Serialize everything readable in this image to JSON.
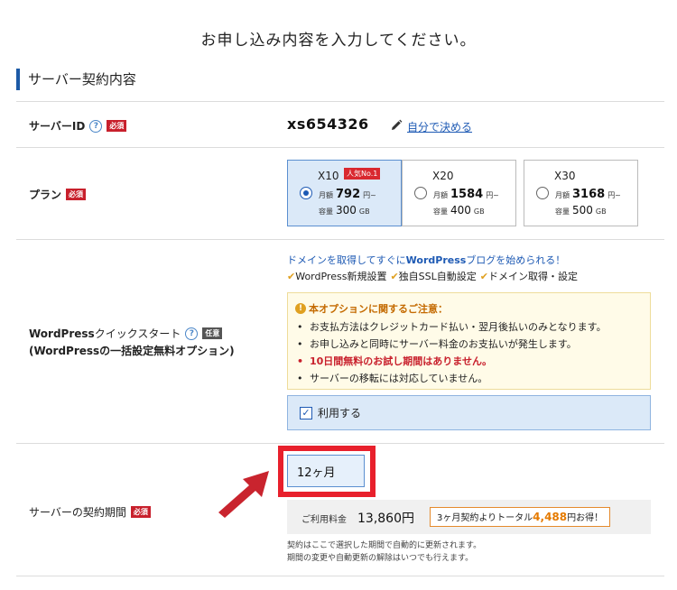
{
  "page": {
    "title": "お申し込み内容を入力してください。"
  },
  "section": {
    "title": "サーバー契約内容"
  },
  "server_id": {
    "label": "サーバーID",
    "help": "?",
    "required": "必須",
    "value": "xs654326",
    "edit_link": "自分で決める"
  },
  "plan": {
    "label": "プラン",
    "required": "必須",
    "options": [
      {
        "name": "X10",
        "badge": "人気No.1",
        "price_prefix": "月額",
        "price": "792",
        "price_unit": "円~",
        "capacity_prefix": "容量",
        "capacity": "300",
        "capacity_unit": "GB",
        "selected": true
      },
      {
        "name": "X20",
        "badge": "",
        "price_prefix": "月額",
        "price": "1584",
        "price_unit": "円~",
        "capacity_prefix": "容量",
        "capacity": "400",
        "capacity_unit": "GB",
        "selected": false
      },
      {
        "name": "X30",
        "badge": "",
        "price_prefix": "月額",
        "price": "3168",
        "price_unit": "円~",
        "capacity_prefix": "容量",
        "capacity": "500",
        "capacity_unit": "GB",
        "selected": false
      }
    ]
  },
  "wordpress": {
    "label_line1_bold": "WordPress",
    "label_line1_rest": "クイックスタート",
    "help": "?",
    "optional": "任意",
    "label_line2": "(WordPressの一括設定無料オプション)",
    "lead_prefix": "ドメインを取得してすぐに",
    "lead_bold": "WordPress",
    "lead_suffix": "ブログを始められる！",
    "features": [
      "WordPress新規設置",
      "独自SSL自動設定",
      "ドメイン取得・設定"
    ],
    "notice_title": "本オプションに関するご注意：",
    "notice_items": [
      "お支払方法はクレジットカード払い・翌月後払いのみとなります。",
      "お申し込みと同時にサーバー料金のお支払いが発生します。",
      "10日間無料のお試し期間はありません。",
      "サーバーの移転には対応していません。"
    ],
    "use_label": "利用する",
    "use_checked": true
  },
  "period": {
    "label": "サーバーの契約期間",
    "required": "必須",
    "selected": "12ヶ月",
    "price_label": "ご利用料金",
    "price_value": "13,860円",
    "promo_prefix": "3ヶ月契約よりトータル",
    "promo_amount": "4,488",
    "promo_suffix": "円お得！",
    "note1": "契約はここで選択した期間で自動的に更新されます。",
    "note2": "期間の変更や自動更新の解除はいつでも行えます。"
  },
  "icons": {
    "help": "question-circle-icon",
    "edit": "pencil-icon",
    "warning": "exclamation-circle-icon",
    "check": "check-icon",
    "arrow": "red-arrow-icon"
  },
  "colors": {
    "accent": "#1e5ab4",
    "required_badge": "#c8202c",
    "selected_bg": "#dbe9f8",
    "highlight": "#e8202c",
    "notice_bg": "#fffbe8",
    "check_orange": "#e0a020"
  }
}
